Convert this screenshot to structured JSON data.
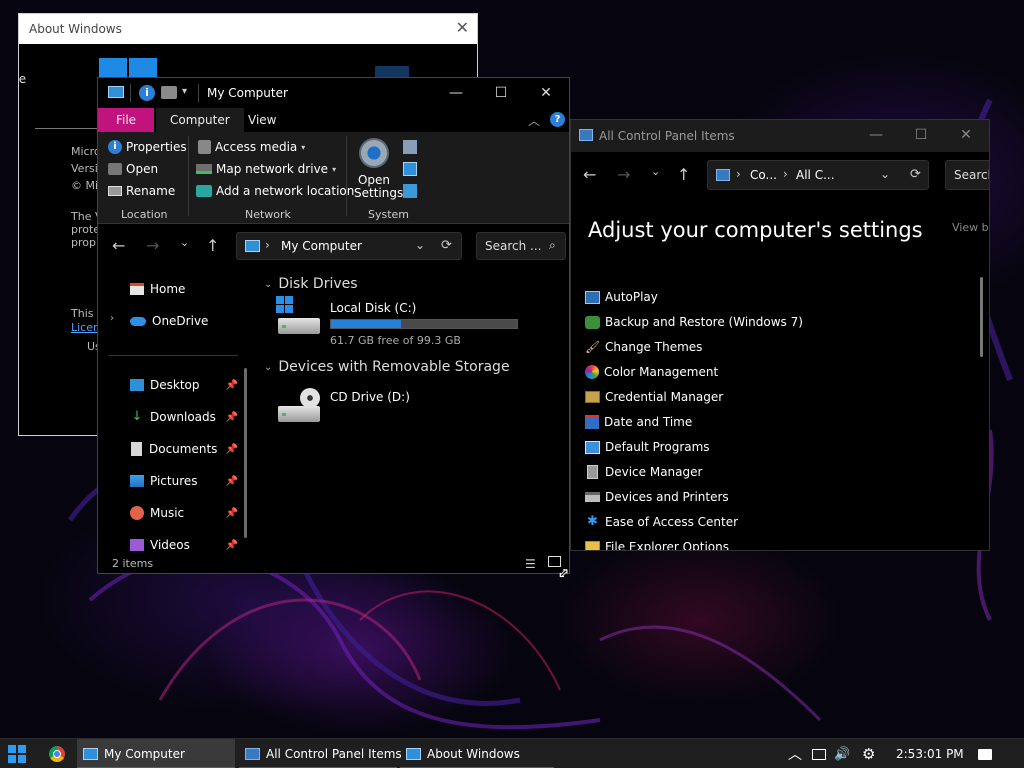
{
  "colors": {
    "accent": "#c1127e",
    "progress": "#2481d7",
    "taskbar_underline": "#d7177f",
    "link": "#4ea1ff"
  },
  "about": {
    "title": "About Windows",
    "close_icon": "close-icon",
    "side_letter": "Re",
    "lines": [
      "Micro",
      "Versi",
      "© Mi",
      "The V",
      "prote",
      "prop",
      "This p",
      "Licen",
      "Us"
    ]
  },
  "mycomputer": {
    "title": "My Computer",
    "tabs": {
      "file": "File",
      "computer": "Computer",
      "view": "View"
    },
    "ribbon": {
      "properties": "Properties",
      "open": "Open",
      "rename": "Rename",
      "access_media": "Access media",
      "map_drive": "Map network drive",
      "add_location": "Add a network location",
      "open_settings_1": "Open",
      "open_settings_2": "Settings",
      "group_location": "Location",
      "group_network": "Network",
      "group_system": "System"
    },
    "address": "My Computer",
    "search_placeholder": "Search ...",
    "sidebar": {
      "home": "Home",
      "onedrive": "OneDrive",
      "desktop": "Desktop",
      "downloads": "Downloads",
      "documents": "Documents",
      "pictures": "Pictures",
      "music": "Music",
      "videos": "Videos"
    },
    "sections": {
      "disk_drives": "Disk Drives",
      "removable": "Devices with Removable Storage"
    },
    "drives": {
      "c_name": "Local Disk (C:)",
      "c_free": "61.7 GB free of 99.3 GB",
      "c_used_fraction": 0.379,
      "d_name": "CD Drive (D:)"
    },
    "status": "2 items"
  },
  "controlpanel": {
    "title": "All Control Panel Items",
    "breadcrumb_1": "Co...",
    "breadcrumb_2": "All C...",
    "search_placeholder": "Search",
    "heading": "Adjust your computer's settings",
    "view_by": "View b",
    "items": [
      "AutoPlay",
      "Backup and Restore (Windows 7)",
      "Change Themes",
      "Color Management",
      "Credential Manager",
      "Date and Time",
      "Default Programs",
      "Device Manager",
      "Devices and Printers",
      "Ease of Access Center",
      "File Explorer Options"
    ]
  },
  "taskbar": {
    "mycomputer": "My Computer",
    "controlpanel": "All Control Panel Items",
    "about": "About Windows",
    "clock": "2:53:01 PM"
  }
}
